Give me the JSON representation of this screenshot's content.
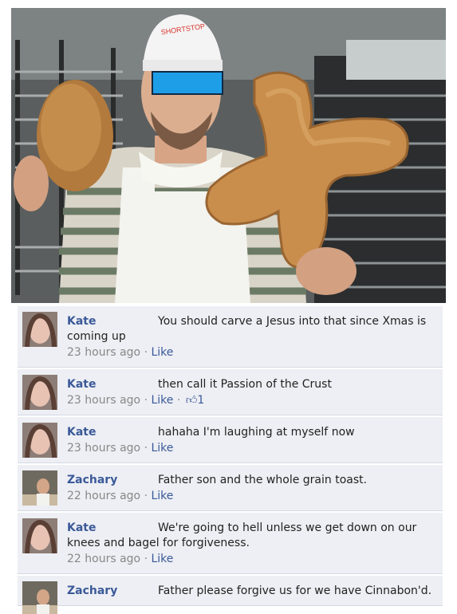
{
  "hat_text": "SHORTSTOP",
  "colors": {
    "link": "#3b5998",
    "comment_bg": "#edeff4",
    "censor_bar": "#1f9ee8"
  },
  "comments": [
    {
      "author": "Kate",
      "text": "You should carve a Jesus into that since Xmas is coming up",
      "time": "23 hours ago",
      "like": "Like",
      "sep": "·",
      "likes": ""
    },
    {
      "author": "Kate",
      "text": "then call it Passion of the Crust",
      "time": "23 hours ago",
      "like": "Like",
      "sep": "·",
      "likes": "1"
    },
    {
      "author": "Kate",
      "text": "hahaha I'm laughing at myself now",
      "time": "23 hours ago",
      "like": "Like",
      "sep": "·",
      "likes": ""
    },
    {
      "author": "Zachary",
      "text": "Father son and the whole grain toast.",
      "time": "22 hours ago",
      "like": "Like",
      "sep": "·",
      "likes": ""
    },
    {
      "author": "Kate",
      "text": "We're going to hell unless we get down on our knees and bagel for forgiveness.",
      "time": "22 hours ago",
      "like": "Like",
      "sep": "·",
      "likes": ""
    },
    {
      "author": "Zachary",
      "text": "Father please forgive us for we have Cinnabon'd.",
      "time": "",
      "like": "",
      "sep": "",
      "likes": ""
    }
  ]
}
